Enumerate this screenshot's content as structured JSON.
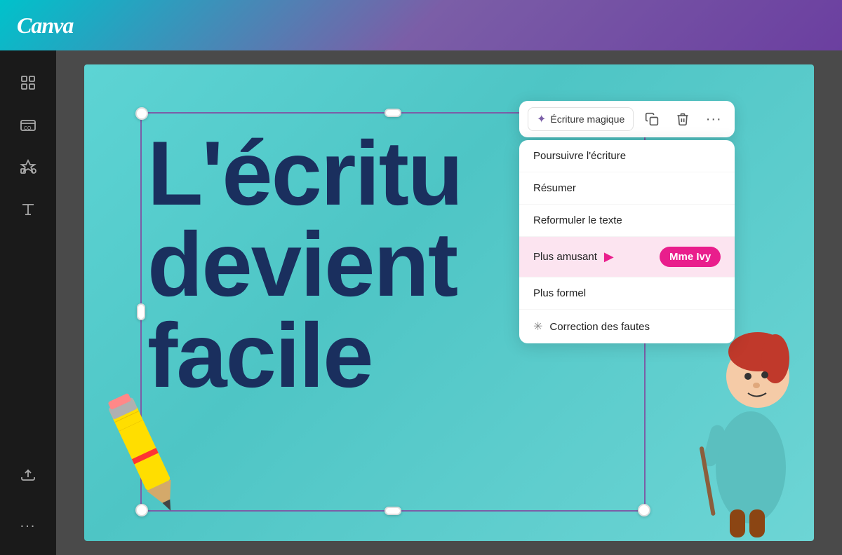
{
  "app": {
    "logo": "Canva"
  },
  "sidebar": {
    "items": [
      {
        "id": "templates",
        "icon": "grid",
        "label": "Modèles"
      },
      {
        "id": "brand",
        "icon": "layers",
        "label": "Marque"
      },
      {
        "id": "elements",
        "icon": "shapes",
        "label": "Éléments"
      },
      {
        "id": "text",
        "icon": "text",
        "label": "Texte"
      },
      {
        "id": "upload",
        "icon": "upload",
        "label": "Importer"
      }
    ],
    "more_label": "..."
  },
  "canvas": {
    "main_text_line1": "L'écritu",
    "main_text_line2": "devient",
    "main_text_line3": "facile"
  },
  "toolbar": {
    "magic_write_label": "Écriture magique",
    "copy_button_label": "Copier",
    "delete_button_label": "Supprimer",
    "more_button_label": "Plus d'options"
  },
  "dropdown": {
    "items": [
      {
        "id": "continue",
        "label": "Poursuivre l'écriture",
        "icon": null,
        "highlighted": false
      },
      {
        "id": "summarize",
        "label": "Résumer",
        "icon": null,
        "highlighted": false
      },
      {
        "id": "rewrite",
        "label": "Reformuler le texte",
        "icon": null,
        "highlighted": false
      },
      {
        "id": "fun",
        "label": "Plus amusant",
        "icon": "arrow",
        "highlighted": true
      },
      {
        "id": "formal",
        "label": "Plus formel",
        "icon": null,
        "highlighted": false
      },
      {
        "id": "fix",
        "label": "Correction des fautes",
        "icon": "sparkle",
        "highlighted": false
      }
    ]
  },
  "badge": {
    "label": "Mme Ivy"
  }
}
